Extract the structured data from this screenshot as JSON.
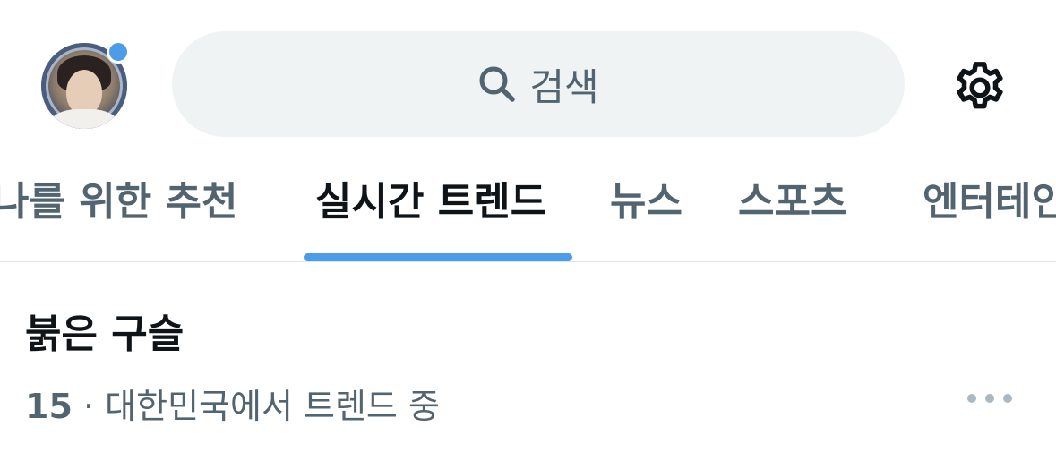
{
  "header": {
    "search": {
      "placeholder": "검색",
      "icon": "search-icon"
    },
    "avatar_icon": "avatar",
    "avatar_notification_color": "#4c9ce9",
    "settings_icon": "gear-icon"
  },
  "tabs": [
    {
      "label": "나를 위한 추천",
      "active": false
    },
    {
      "label": "실시간 트렌드",
      "active": true
    },
    {
      "label": "뉴스",
      "active": false
    },
    {
      "label": "스포츠",
      "active": false
    },
    {
      "label": "엔터테인",
      "active": false
    }
  ],
  "trend": {
    "title": "붉은 구슬",
    "rank": "15",
    "separator": "·",
    "context": "대한민국에서 트렌드 중",
    "more_icon": "more-icon"
  },
  "colors": {
    "accent": "#4c9ce9",
    "primary_text": "#0f1419",
    "secondary_text": "#536471",
    "search_background": "#eff3f4"
  }
}
